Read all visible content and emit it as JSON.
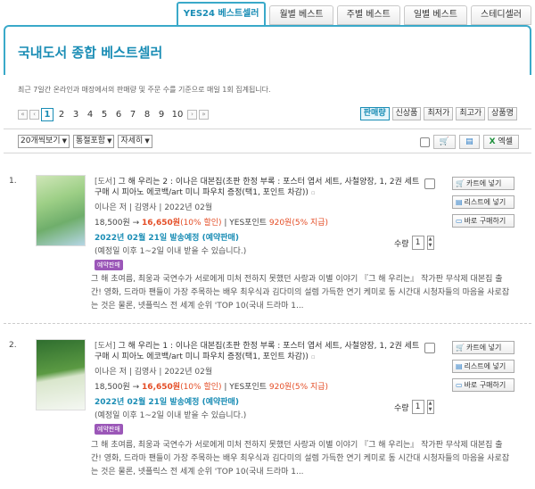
{
  "tabs": [
    {
      "label": "YES24 베스트셀러",
      "active": true
    },
    {
      "label": "월별 베스트",
      "active": false
    },
    {
      "label": "주별 베스트",
      "active": false
    },
    {
      "label": "일별 베스트",
      "active": false
    },
    {
      "label": "스테디셀러",
      "active": false
    }
  ],
  "page_title": "국내도서 종합 베스트셀러",
  "description": "최근 7일간 온라인과 매장에서의 판매량 및 주문 수를 기준으로 매일 1회 집계됩니다.",
  "pager": {
    "first": "«",
    "prev": "‹",
    "next": "›",
    "last": "»",
    "pages": [
      "1",
      "2",
      "3",
      "4",
      "5",
      "6",
      "7",
      "8",
      "9",
      "10"
    ],
    "current": "1"
  },
  "sorts": [
    {
      "label": "판매량",
      "on": true
    },
    {
      "label": "신상품",
      "on": false
    },
    {
      "label": "최저가",
      "on": false
    },
    {
      "label": "최고가",
      "on": false
    },
    {
      "label": "상품명",
      "on": false
    }
  ],
  "toolbar": {
    "view_count": "20개씩보기",
    "bundle": "통절포함",
    "detail": "자세히",
    "cart_icon": "🛒",
    "list_icon": "▤",
    "excel_label": "엑셀",
    "excel_icon": "X"
  },
  "items": [
    {
      "rank": "1.",
      "category": "[도서]",
      "title": " 그 해 우리는 2 : 이나은 대본집(초판 한정 부록 : 포스터 엽서 세트, 사철양장, 1, 2권 세트 구매 시 피아노 에코백/art 미니 파우치 증정(택1, 포인트 차감))",
      "author_pub": "이나은 저 | 김영사 | 2022년 02월",
      "price_list": "18,500원 → ",
      "price_sale": "16,650원",
      "discount": "(10% 할인)",
      "points_prefix": " | YES포인트 ",
      "points": "920원(5% 지급)",
      "ship": "2022년 02월 21일 발송예정 (예약판매)",
      "ship_note": "(예정일 이후 1~2일 이내 받을 수 있습니다.)",
      "badge": "예약판매",
      "qty_label": "수량",
      "qty": "1",
      "cart": "카트에 넣기",
      "wish": "리스트에 넣기",
      "buy": "바로 구매하기",
      "blurb": "그 해 초여름, 최웅과 국연수가 서로에게 미처 전하지 못했던 사랑과 이별 이야기 『그 해 우리는』 작가판 무삭제 대본집 출간! 영화, 드라마 팬들이 가장 주목하는 배우 최우식과 김다미의 설렘 가득한 연기 케미로 동 시간대 시청자들의 마음을 사로잡는 것은 물론, 넷플릭스 전 세계 순위 'TOP 10(국내 드라마 1..."
    },
    {
      "rank": "2.",
      "category": "[도서]",
      "title": " 그 해 우리는 1 : 이나은 대본집(초판 한정 부록 : 포스터 엽서 세트, 사철양장, 1, 2권 세트 구매 시 피아노 에코백/art 미니 파우치 증정(택1, 포인트 차감))",
      "author_pub": "이나은 저 | 김영사 | 2022년 02월",
      "price_list": "18,500원 → ",
      "price_sale": "16,650원",
      "discount": "(10% 할인)",
      "points_prefix": " | YES포인트 ",
      "points": "920원(5% 지급)",
      "ship": "2022년 02월 21일 발송예정 (예약판매)",
      "ship_note": "(예정일 이후 1~2일 이내 받을 수 있습니다.)",
      "badge": "예약판매",
      "qty_label": "수량",
      "qty": "1",
      "cart": "카트에 넣기",
      "wish": "리스트에 넣기",
      "buy": "바로 구매하기",
      "blurb": "그 해 초여름, 최웅과 국연수가 서로에게 미처 전하지 못했던 사랑과 이별 이야기 『그 해 우리는』 작가판 무삭제 대본집 출간! 영화, 드라마 팬들이 가장 주목하는 배우 최우식과 김다미의 설렘 가득한 연기 케미로 동 시간대 시청자들의 마음을 사로잡는 것은 물론, 넷플릭스 전 세계 순위 'TOP 10(국내 드라마 1..."
    }
  ],
  "colors": {
    "accent": "#1a8db5",
    "sale": "#e44d26",
    "badge": "#9b57b8"
  }
}
